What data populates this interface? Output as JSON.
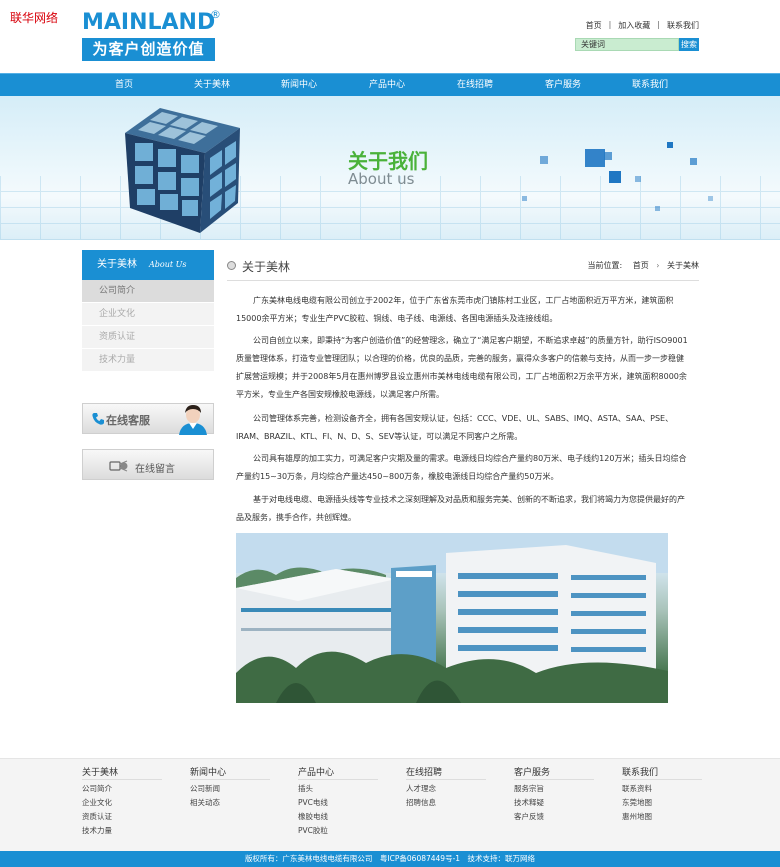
{
  "watermark": "联华网络",
  "header": {
    "logo_text": "MAINLAND",
    "logo_reg": "®",
    "slogan": "为客户创造价值",
    "top_links": [
      "首页",
      "加入收藏",
      "联系我们"
    ],
    "search_placeholder": "关键词",
    "search_button": "搜索"
  },
  "nav": [
    "首页",
    "关于美林",
    "新闻中心",
    "产品中心",
    "在线招聘",
    "客户服务",
    "联系我们"
  ],
  "banner": {
    "title": "关于我们",
    "subtitle": "About us"
  },
  "sidebar": {
    "title": "关于美林",
    "title_en": "About Us",
    "items": [
      "公司简介",
      "企业文化",
      "资质认证",
      "技术力量"
    ],
    "promo_service": "在线客服",
    "promo_message": "在线留言"
  },
  "content": {
    "title": "关于美林",
    "breadcrumb_label": "当前位置:",
    "breadcrumb_home": "首页",
    "breadcrumb_current": "关于美林",
    "paragraphs": [
      "广东美林电线电缆有限公司创立于2002年，位于广东省东莞市虎门镇陈村工业区，工厂占地面积近万平方米，建筑面积15000余平方米；专业生产PVC胶粒、铜线、电子线、电源线、各国电源插头及连接线组。",
      "公司自创立以来，即秉持“为客户创造价值”的经营理念，确立了“满足客户期望，不断追求卓越”的质量方针，助行ISO9001质量管理体系，打造专业管理团队；以合理的价格，优良的品质，完善的服务，赢得众多客户的信赖与支持，从而一步一步稳健扩展营运规模；并于2008年5月在惠州博罗县设立惠州市美林电线电缆有限公司，工厂占地面积2万余平方米，建筑面积8000余平方米，专业生产各国安规橡胶电源线，以满足客户所需。",
      "公司管理体系完善，检测设备齐全，拥有各国安规认证，包括：CCC、VDE、UL、SABS、IMQ、ASTA、SAA、PSE、IRAM、BRAZIL、KTL、FI、N、D、S、SEV等认证，可以满足不同客户之所需。",
      "公司具有雄厚的加工实力，可满足客户灾期及量的需求。电源线日均综合产量约80万米、电子线约120万米；插头日均综合产量约15~30万条，月均综合产量达450~800万条，橡胶电源线日均综合产量约50万米。",
      "基于对电线电缆、电源插头线等专业技术之深刻理解及对品质和服务完美、创新的不断追求，我们将竭力为您提供最好的产品及服务，携手合作，共创辉煌。"
    ]
  },
  "footer": {
    "columns": [
      {
        "title": "关于美林",
        "links": [
          "公司简介",
          "企业文化",
          "资质认证",
          "技术力量"
        ]
      },
      {
        "title": "新闻中心",
        "links": [
          "公司新闻",
          "相关动态"
        ]
      },
      {
        "title": "产品中心",
        "links": [
          "插头",
          "PVC电线",
          "橡胶电线",
          "PVC胶粒"
        ]
      },
      {
        "title": "在线招聘",
        "links": [
          "人才理念",
          "招聘信息"
        ]
      },
      {
        "title": "客户服务",
        "links": [
          "服务宗旨",
          "技术释疑",
          "客户反馈"
        ]
      },
      {
        "title": "联系我们",
        "links": [
          "联系资料",
          "东莞地图",
          "惠州地图"
        ]
      }
    ],
    "copyright": "版权所有：广东美林电线电缆有限公司　粤ICP备06087449号-1　技术支持：联万网络"
  },
  "colors": {
    "brand_blue": "#1a8fd3",
    "accent_green": "#4ab23a"
  }
}
